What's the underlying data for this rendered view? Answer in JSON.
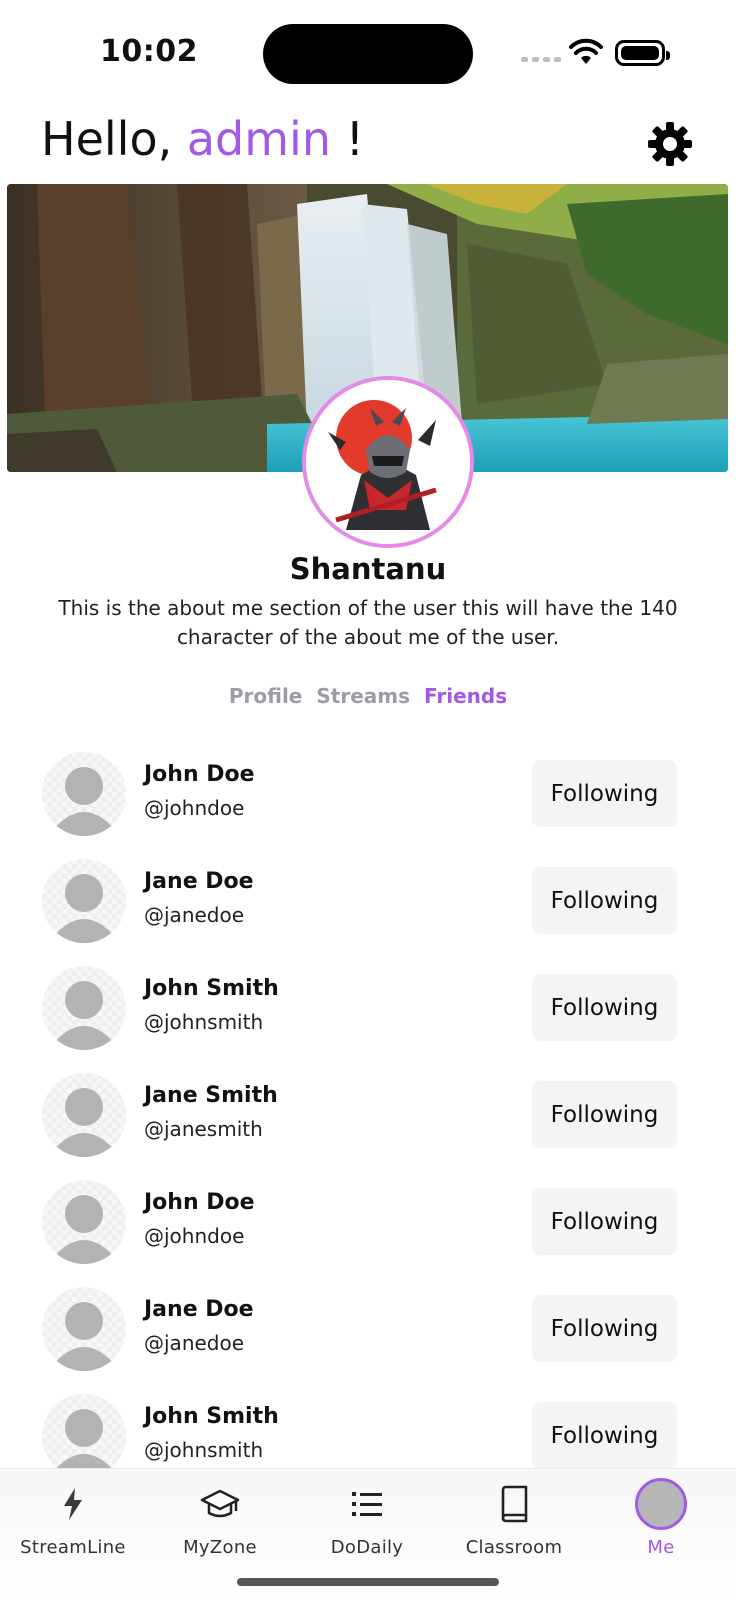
{
  "status_bar": {
    "time": "10:02"
  },
  "header": {
    "greeting_prefix": "Hello, ",
    "greeting_name": "admin",
    "greeting_suffix": " !"
  },
  "profile": {
    "name": "Shantanu",
    "about": "This is the about me section of the user this will have the 140 character of the about me of the user."
  },
  "tabs": [
    {
      "label": "Profile",
      "active": false
    },
    {
      "label": "Streams",
      "active": false
    },
    {
      "label": "Friends",
      "active": true
    }
  ],
  "friends": [
    {
      "name": "John Doe",
      "handle": "@johndoe",
      "action": "Following"
    },
    {
      "name": "Jane Doe",
      "handle": "@janedoe",
      "action": "Following"
    },
    {
      "name": "John Smith",
      "handle": "@johnsmith",
      "action": "Following"
    },
    {
      "name": "Jane Smith",
      "handle": "@janesmith",
      "action": "Following"
    },
    {
      "name": "John Doe",
      "handle": "@johndoe",
      "action": "Following"
    },
    {
      "name": "Jane Doe",
      "handle": "@janedoe",
      "action": "Following"
    },
    {
      "name": "John Smith",
      "handle": "@johnsmith",
      "action": "Following"
    }
  ],
  "bottom_nav": [
    {
      "label": "StreamLine",
      "icon": "bolt-icon"
    },
    {
      "label": "MyZone",
      "icon": "graduation-cap-icon"
    },
    {
      "label": "DoDaily",
      "icon": "list-icon"
    },
    {
      "label": "Classroom",
      "icon": "book-icon"
    },
    {
      "label": "Me",
      "icon": "avatar-icon",
      "active": true
    }
  ],
  "colors": {
    "accent": "#a259e6",
    "avatar_ring": "#e58ae6",
    "button_bg": "#f3f4f6"
  }
}
